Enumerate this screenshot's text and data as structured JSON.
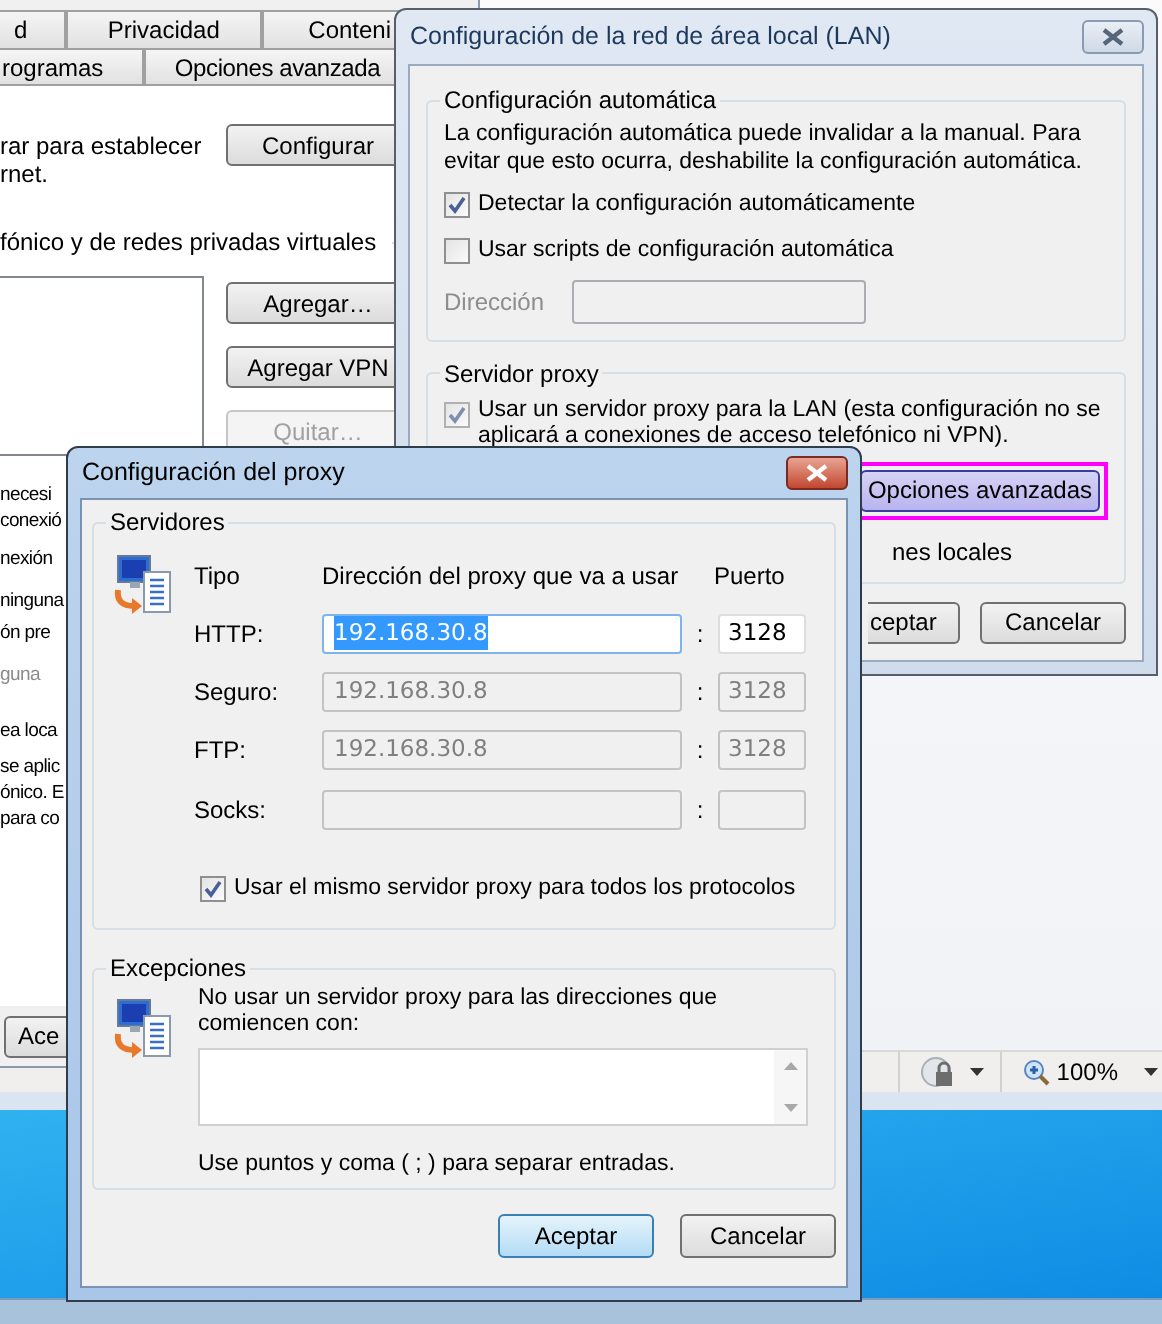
{
  "browser": {
    "status_bar": {
      "zoom": "100%"
    }
  },
  "internet_options": {
    "tabs_row_1": [
      {
        "label": "d",
        "selected": false
      },
      {
        "label": "Privacidad",
        "selected": false
      },
      {
        "label": "Conteni",
        "selected": false
      }
    ],
    "tabs_row_2": [
      {
        "label": "rogramas",
        "selected": false
      },
      {
        "label": "Opciones avanzada",
        "selected": false
      }
    ],
    "setup_text": [
      "rar para establecer",
      "rnet."
    ],
    "setup_button": "Configurar",
    "vpn_heading": "fónico y de redes privadas virtuales",
    "vpn_buttons": [
      {
        "label": "Agregar…",
        "disabled": false
      },
      {
        "label": "Agregar VPN",
        "disabled": false
      },
      {
        "label": "Quitar…",
        "disabled": true
      }
    ],
    "fragments": [
      {
        "text": "necesi",
        "disabled": false
      },
      {
        "text": "conexió",
        "disabled": false
      },
      {
        "text": "nexión",
        "disabled": false
      },
      {
        "text": "ninguna",
        "disabled": false
      },
      {
        "text": "ón pre",
        "disabled": false
      },
      {
        "text": "guna",
        "disabled": true
      },
      {
        "text": "ea loca",
        "disabled": false
      },
      {
        "text": "se aplic",
        "disabled": false
      },
      {
        "text": "ónico. E",
        "disabled": false
      },
      {
        "text": "para co",
        "disabled": false
      }
    ],
    "ok_button": "Ace"
  },
  "lan_dialog": {
    "title": "Configuración de la red de área local (LAN)",
    "auto_group": {
      "title": "Configuración automática",
      "description": "La configuración automática puede invalidar a la manual. Para evitar que esto ocurra, deshabilite la configuración automática.",
      "checkboxes": [
        {
          "label": "Detectar la configuración automáticamente",
          "checked": true
        },
        {
          "label": "Usar scripts de configuración automática",
          "checked": false
        }
      ],
      "address": {
        "label": "Dirección",
        "disabled": true
      }
    },
    "proxy_group": {
      "title": "Servidor proxy",
      "use_proxy": {
        "label": "Usar un servidor proxy para la LAN (esta configuración no se aplicará a conexiones de acceso telefónico ni VPN).",
        "checked": true
      },
      "advanced_button": {
        "label": "Opciones avanzadas",
        "highlighted": true
      },
      "bypass_fragment": "nes locales"
    },
    "buttons": [
      "ceptar",
      "Cancelar"
    ]
  },
  "proxy_dialog": {
    "title": "Configuración del proxy",
    "servers_group": {
      "title": "Servidores",
      "headers": [
        "Tipo",
        "Dirección del proxy que va a usar",
        "Puerto"
      ],
      "rows": [
        {
          "type": "HTTP:",
          "address": "192.168.30.8",
          "separator": ":",
          "port": "3128",
          "disabled": false,
          "text_selected": true
        },
        {
          "type": "Seguro:",
          "address": "192.168.30.8",
          "separator": ":",
          "port": "3128",
          "disabled": true,
          "text_selected": false
        },
        {
          "type": "FTP:",
          "address": "192.168.30.8",
          "separator": ":",
          "port": "3128",
          "disabled": true,
          "text_selected": false
        },
        {
          "type": "Socks:",
          "separator": ":",
          "disabled": true,
          "text_selected": false
        }
      ],
      "same_for_all": {
        "label": "Usar el mismo servidor proxy para todos los protocolos",
        "checked": true
      }
    },
    "exceptions_group": {
      "title": "Excepciones",
      "description": "No usar un servidor proxy para las direcciones que comiencen con:",
      "note": "Use puntos y coma ( ; ) para separar entradas."
    },
    "buttons": [
      {
        "label": "Aceptar",
        "default": true
      },
      {
        "label": "Cancelar",
        "default": false
      }
    ]
  }
}
